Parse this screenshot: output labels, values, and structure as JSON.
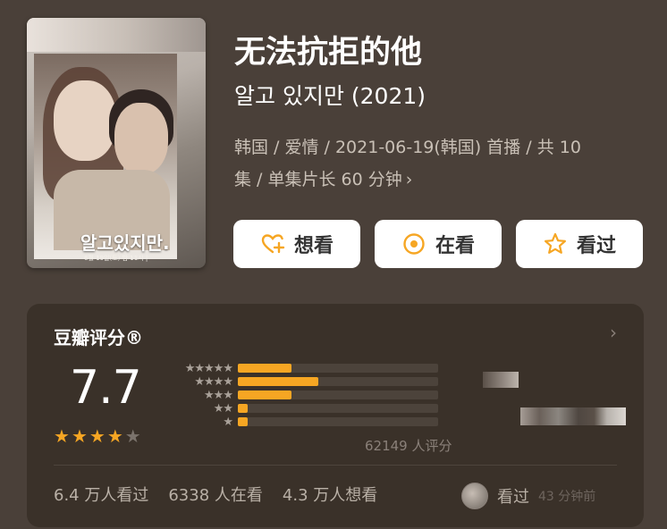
{
  "poster": {
    "title_text": "알고있지만.",
    "small_line": "6월 19일(토) 밤 11시 |"
  },
  "movie": {
    "title": "无法抗拒的他",
    "original_title": "알고 있지만 (2021)",
    "meta_line1": "韩国 / 爱情 / 2021-06-19(韩国) 首播 / 共 10",
    "meta_line2": "集 / 单集片长 60 分钟"
  },
  "actions": {
    "want_label": "想看",
    "doing_label": "在看",
    "done_label": "看过"
  },
  "rating": {
    "card_title": "豆瓣评分®",
    "score": "7.7",
    "stars_filled": 4,
    "stars_total": 5,
    "distribution": [
      {
        "stars": 5,
        "label": "★★★★★",
        "fraction": 0.27
      },
      {
        "stars": 4,
        "label": "★★★★",
        "fraction": 0.4
      },
      {
        "stars": 3,
        "label": "★★★",
        "fraction": 0.27
      },
      {
        "stars": 2,
        "label": "★★",
        "fraction": 0.05
      },
      {
        "stars": 1,
        "label": "★",
        "fraction": 0.05
      }
    ],
    "count_text": "62149 人评分"
  },
  "stats": {
    "watched": "6.4 万人看过",
    "watching": "6338 人在看",
    "want": "4.3 万人想看"
  },
  "recent": {
    "action": "看过",
    "time": "43 分钟前"
  },
  "colors": {
    "background": "#4a4039",
    "card": "#3a3129",
    "accent": "#f6a623"
  }
}
